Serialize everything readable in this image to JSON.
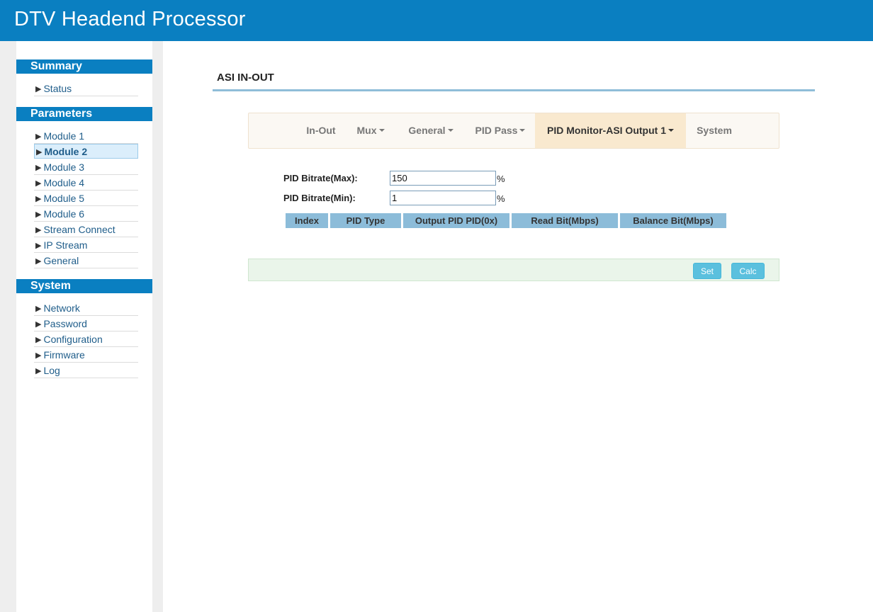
{
  "app": {
    "title": "DTV Headend Processor"
  },
  "sidebar": {
    "sections": [
      {
        "header": "Summary",
        "items": [
          "Status"
        ]
      },
      {
        "header": "Parameters",
        "items": [
          "Module 1",
          "Module 2",
          "Module 3",
          "Module 4",
          "Module 5",
          "Module 6",
          "Stream Connect",
          "IP Stream",
          "General"
        ],
        "active": "Module 2"
      },
      {
        "header": "System",
        "items": [
          "Network",
          "Password",
          "Configuration",
          "Firmware",
          "Log"
        ]
      }
    ],
    "arrow_icon": "triangle-right-icon"
  },
  "page": {
    "title": "ASI IN-OUT",
    "tabs": [
      {
        "label": "In-Out",
        "dropdown": false
      },
      {
        "label": "Mux",
        "dropdown": true
      },
      {
        "label": "General",
        "dropdown": true
      },
      {
        "label": "PID Pass",
        "dropdown": true
      },
      {
        "label": "PID Monitor-ASI Output 1",
        "dropdown": true,
        "active": true
      },
      {
        "label": "System",
        "dropdown": false
      }
    ],
    "form": {
      "max_label": "PID Bitrate(Max):",
      "max_value": "150",
      "min_label": "PID Bitrate(Min):",
      "min_value": "1",
      "unit": "%"
    },
    "table": {
      "columns": [
        "Index",
        "PID Type",
        "Output PID PID(0x)",
        "Read Bit(Mbps)",
        "Balance Bit(Mbps)"
      ],
      "rows": []
    },
    "actions": {
      "set_label": "Set",
      "calc_label": "Calc"
    }
  },
  "colors": {
    "brand": "#0a7fc1",
    "table_header": "#8cbcd9",
    "active_tab": "#f9e9cf",
    "button": "#5bc0de"
  }
}
